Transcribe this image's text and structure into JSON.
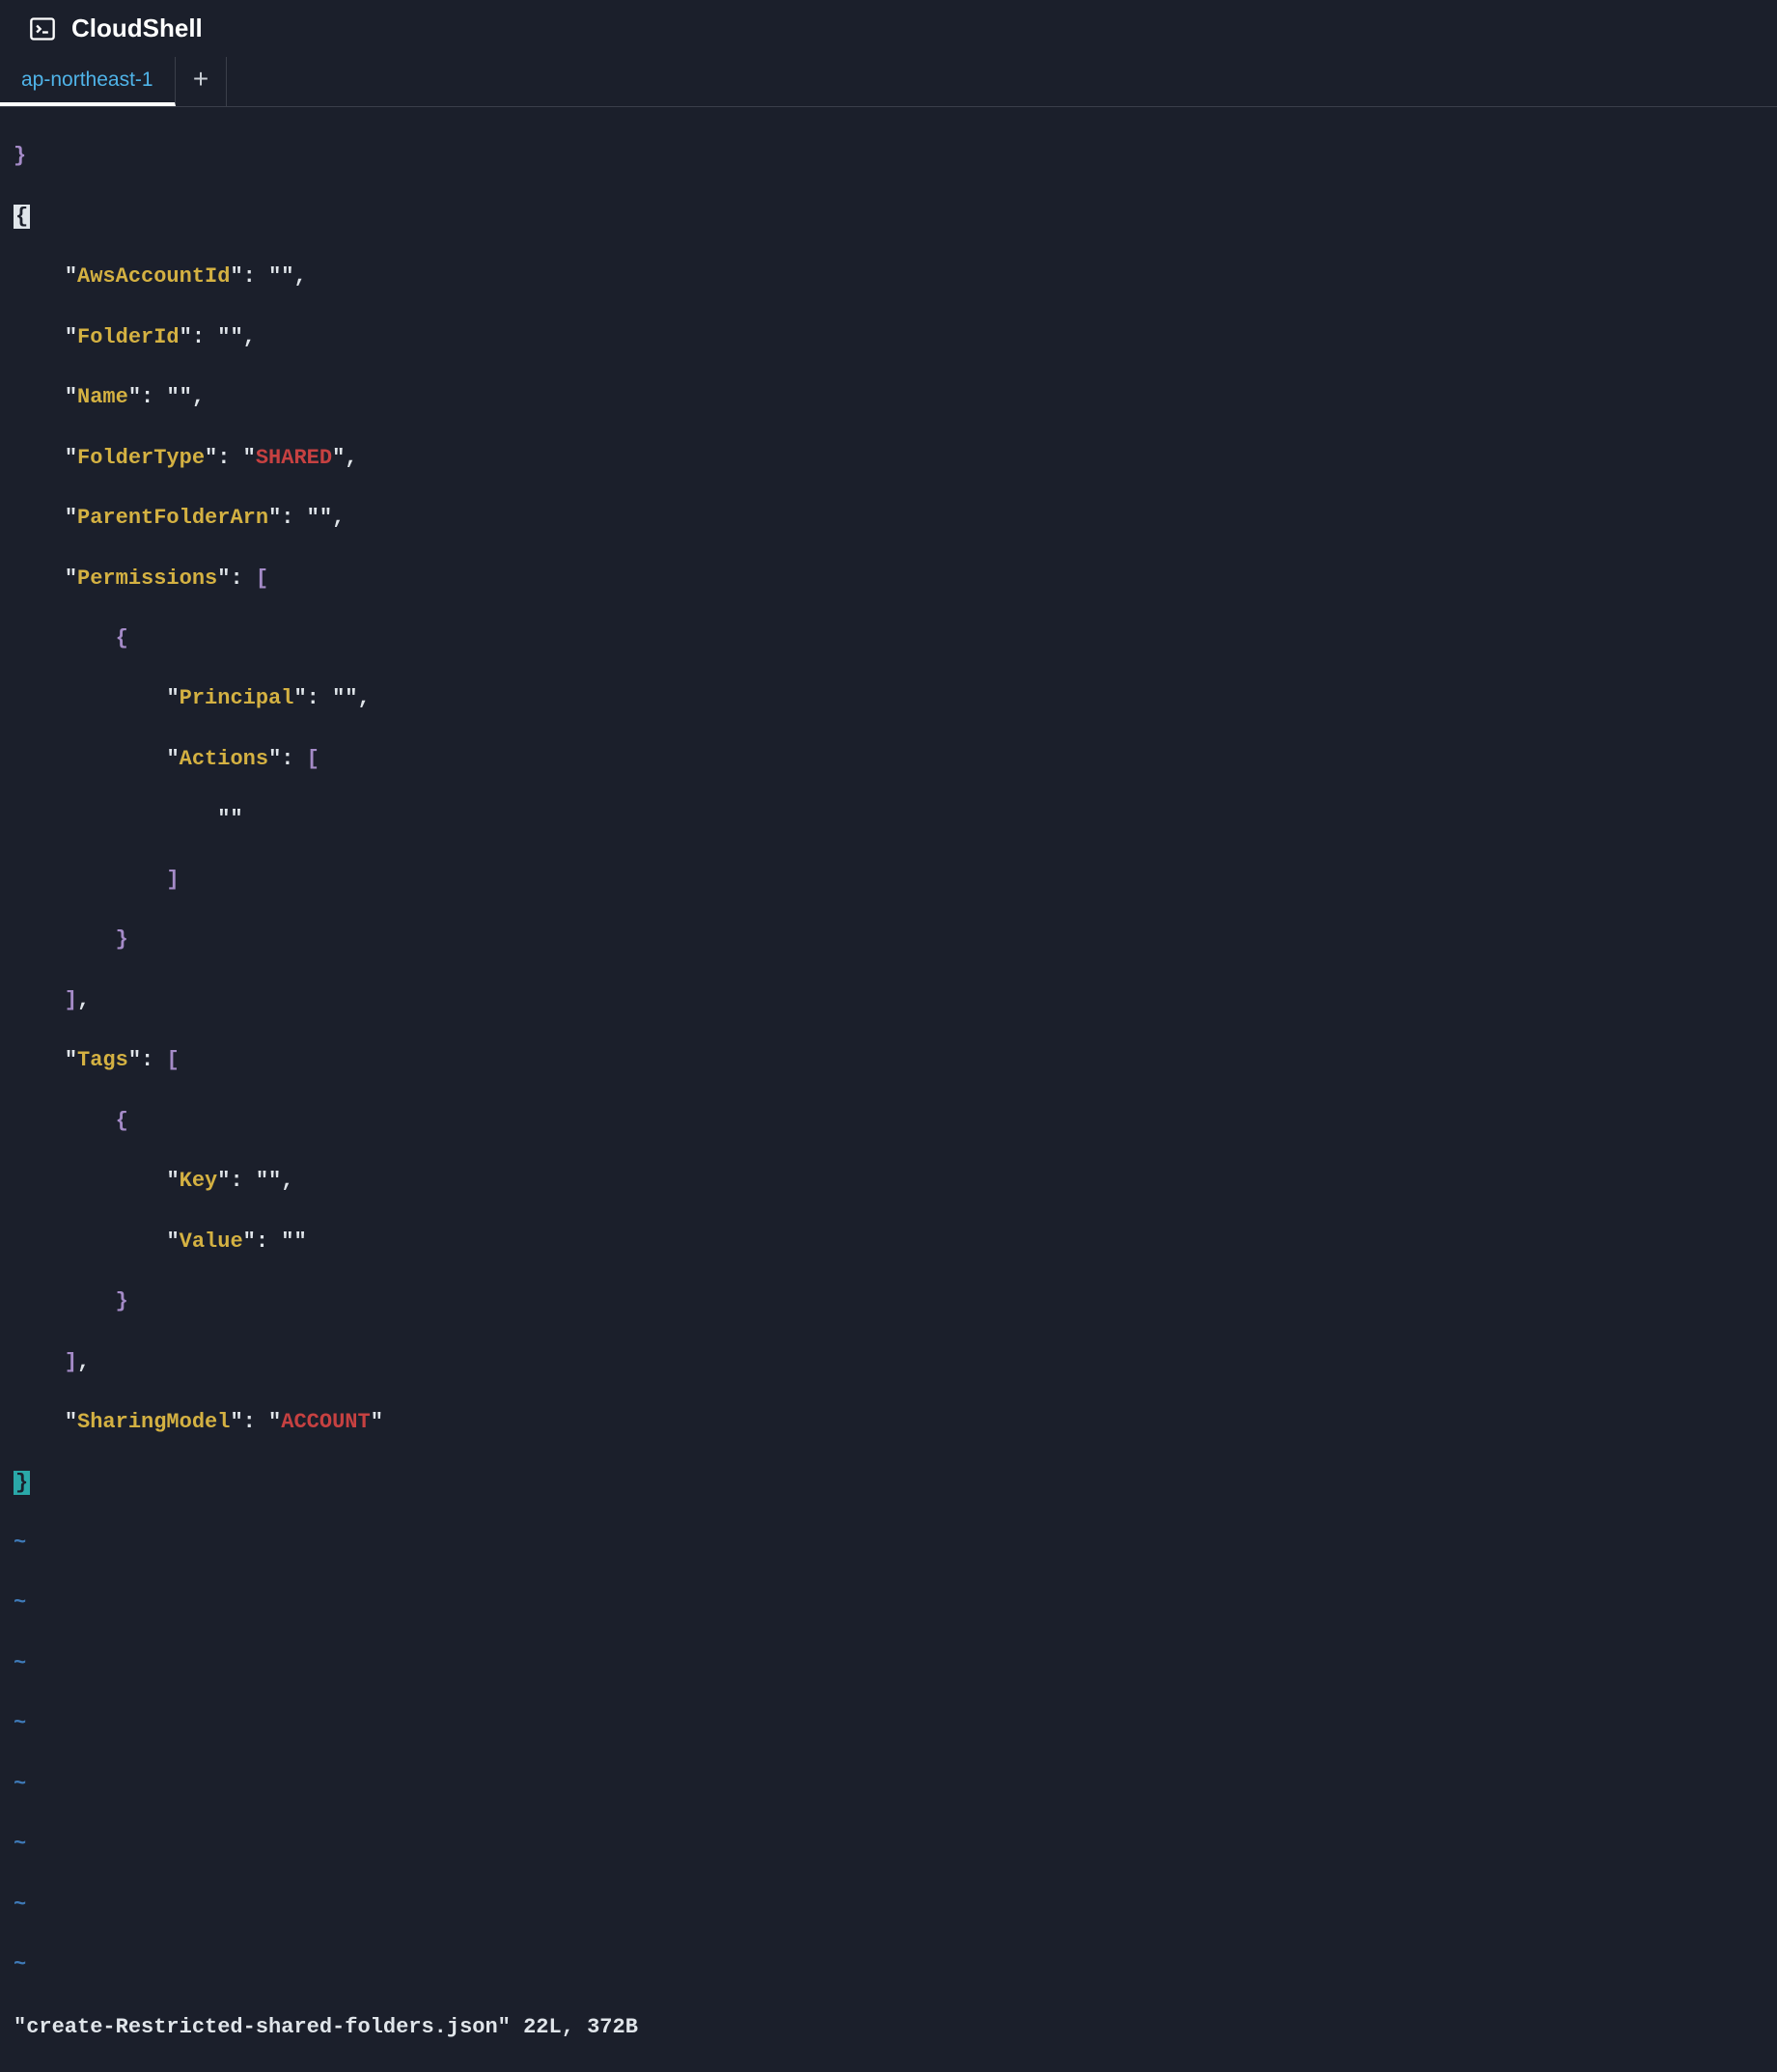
{
  "header": {
    "title": "CloudShell"
  },
  "tabs": {
    "active": "ap-northeast-1",
    "add_label": "+"
  },
  "editor": {
    "pre_brace": "}",
    "open_brace": "{",
    "close_brace": "}",
    "keys": {
      "awsAccountId": "AwsAccountId",
      "folderId": "FolderId",
      "name": "Name",
      "folderType": "FolderType",
      "parentFolderArn": "ParentFolderArn",
      "permissions": "Permissions",
      "principal": "Principal",
      "actions": "Actions",
      "tags": "Tags",
      "key": "Key",
      "value": "Value",
      "sharingModel": "SharingModel"
    },
    "values": {
      "empty": "\"\"",
      "shared": "SHARED",
      "account": "ACCOUNT"
    },
    "tilde": "~"
  },
  "status": {
    "filename": "\"create-Restricted-shared-folders.json\"",
    "lines": "22L,",
    "bytes": "372B"
  }
}
